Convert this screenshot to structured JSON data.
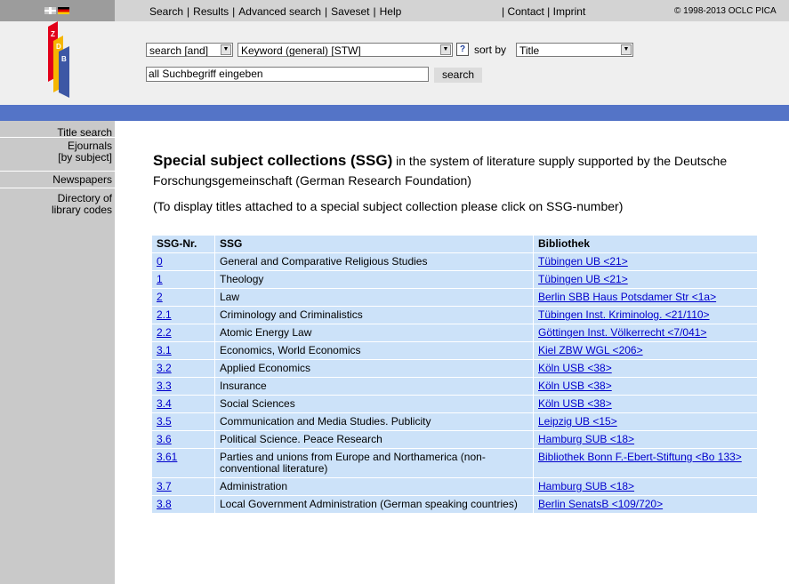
{
  "top_nav": {
    "items": [
      "Search",
      "Results",
      "Advanced search",
      "Saveset",
      "Help"
    ],
    "contact": "Contact",
    "imprint": "Imprint",
    "copyright": "© 1998-2013 OCLC PICA"
  },
  "logo": {
    "letters": [
      "Z",
      "D",
      "B"
    ],
    "colors": {
      "red": "#e2001a",
      "yellow": "#f6b600",
      "blue": "#3d57a5"
    }
  },
  "search": {
    "mode": "search [and]",
    "field": "Keyword (general) [STW]",
    "help": "?",
    "sort_label": "sort by",
    "sort_value": "Title",
    "input_value": "all Suchbegriff eingeben",
    "button": "search"
  },
  "sidebar": {
    "title_search": "Title search",
    "ejournals_1": "Ejournals",
    "ejournals_2": "[by subject]",
    "newspapers": "Newspapers",
    "directory_1": "Directory of",
    "directory_2": "library codes"
  },
  "main": {
    "heading_bold": "Special subject collections (SSG)",
    "heading_rest": " in the system of literature supply supported by the Deutsche Forschungsgemeinschaft (German Research Foundation)",
    "hint": "(To display titles attached to a special subject collection please click on SSG-number)"
  },
  "table": {
    "headers": [
      "SSG-Nr.",
      "SSG",
      "Bibliothek"
    ],
    "rows": [
      [
        "0",
        "General and Comparative Religious Studies",
        "Tübingen UB <21>"
      ],
      [
        "1",
        "Theology",
        "Tübingen UB <21>"
      ],
      [
        "2",
        "Law",
        "Berlin SBB Haus Potsdamer Str <1a>"
      ],
      [
        "2.1",
        "Criminology and Criminalistics",
        "Tübingen Inst. Kriminolog. <21/110>"
      ],
      [
        "2.2",
        "Atomic Energy Law",
        "Göttingen Inst. Völkerrecht <7/041>"
      ],
      [
        "3.1",
        "Economics, World Economics",
        "Kiel ZBW WGL <206>"
      ],
      [
        "3.2",
        "Applied Economics",
        "Köln USB <38>"
      ],
      [
        "3.3",
        "Insurance",
        "Köln USB <38>"
      ],
      [
        "3.4",
        "Social Sciences",
        "Köln USB <38>"
      ],
      [
        "3.5",
        "Communication and Media Studies. Publicity",
        "Leipzig UB <15>"
      ],
      [
        "3.6",
        "Political Science. Peace Research",
        "Hamburg SUB <18>"
      ],
      [
        "3.61",
        "Parties and unions from Europe and Northamerica (non-conventional literature)",
        "Bibliothek Bonn F.-Ebert-Stiftung <Bo 133>"
      ],
      [
        "3.7",
        "Administration",
        "Hamburg SUB <18>"
      ],
      [
        "3.8",
        "Local Government Administration (German speaking countries)",
        "Berlin SenatsB <109/720>"
      ]
    ]
  }
}
